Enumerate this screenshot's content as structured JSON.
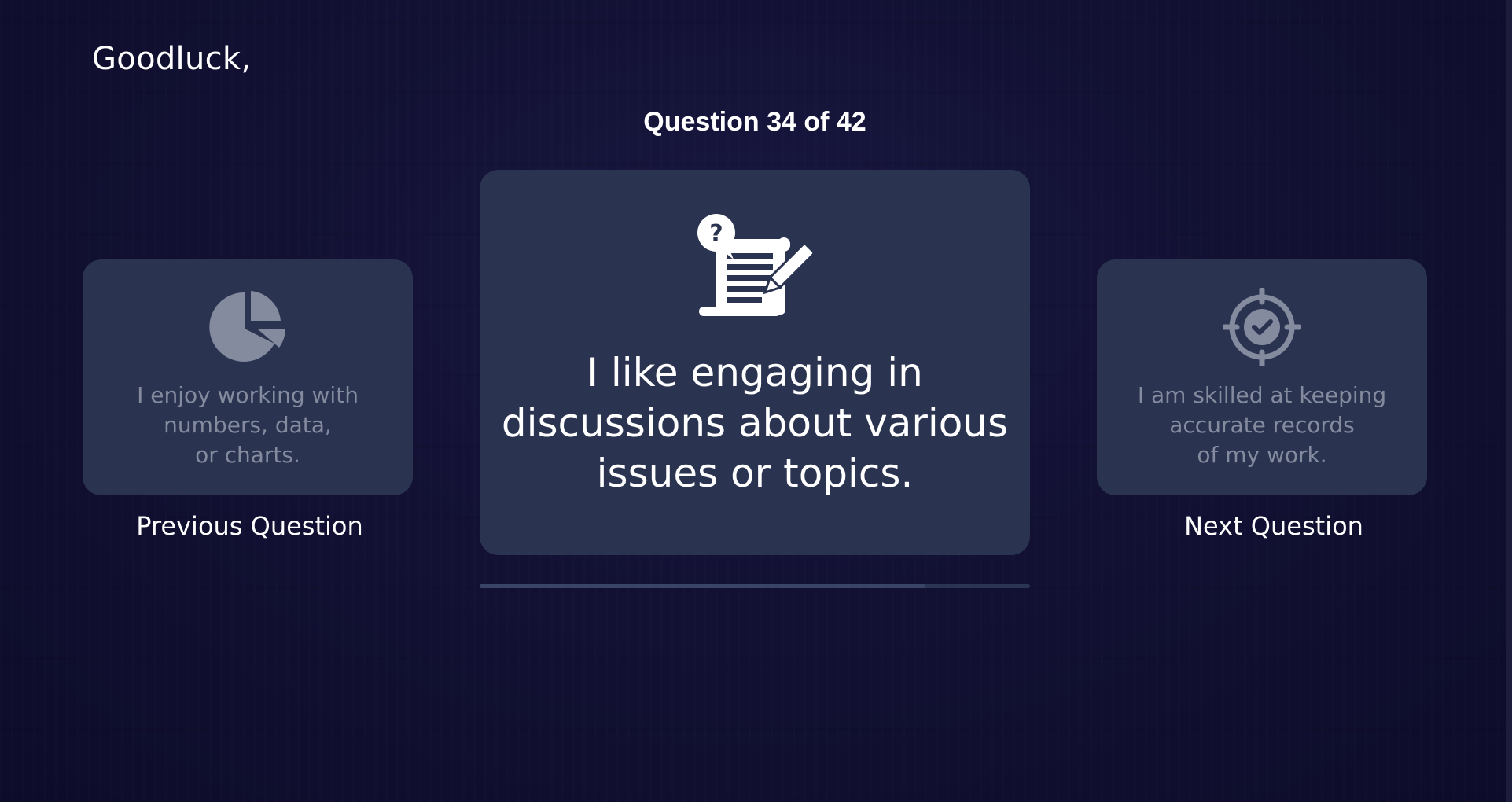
{
  "greeting": "Goodluck,",
  "progress": {
    "label": "Question 34 of 42",
    "current": 34,
    "total": 42
  },
  "previous_card": {
    "icon": "pie-chart-icon",
    "text": "I enjoy working with\nnumbers, data,\nor charts."
  },
  "current_card": {
    "icon": "questionnaire-icon",
    "text": "I like engaging in\ndiscussions about various\nissues or topics."
  },
  "next_card": {
    "icon": "target-check-icon",
    "text": "I am skilled at keeping\naccurate records\nof my work."
  },
  "nav": {
    "previous_label": "Previous Question",
    "next_label": "Next Question"
  },
  "colors": {
    "background": "#121134",
    "card": "#2a3350",
    "muted_text": "#848b9f",
    "text": "#ffffff"
  }
}
